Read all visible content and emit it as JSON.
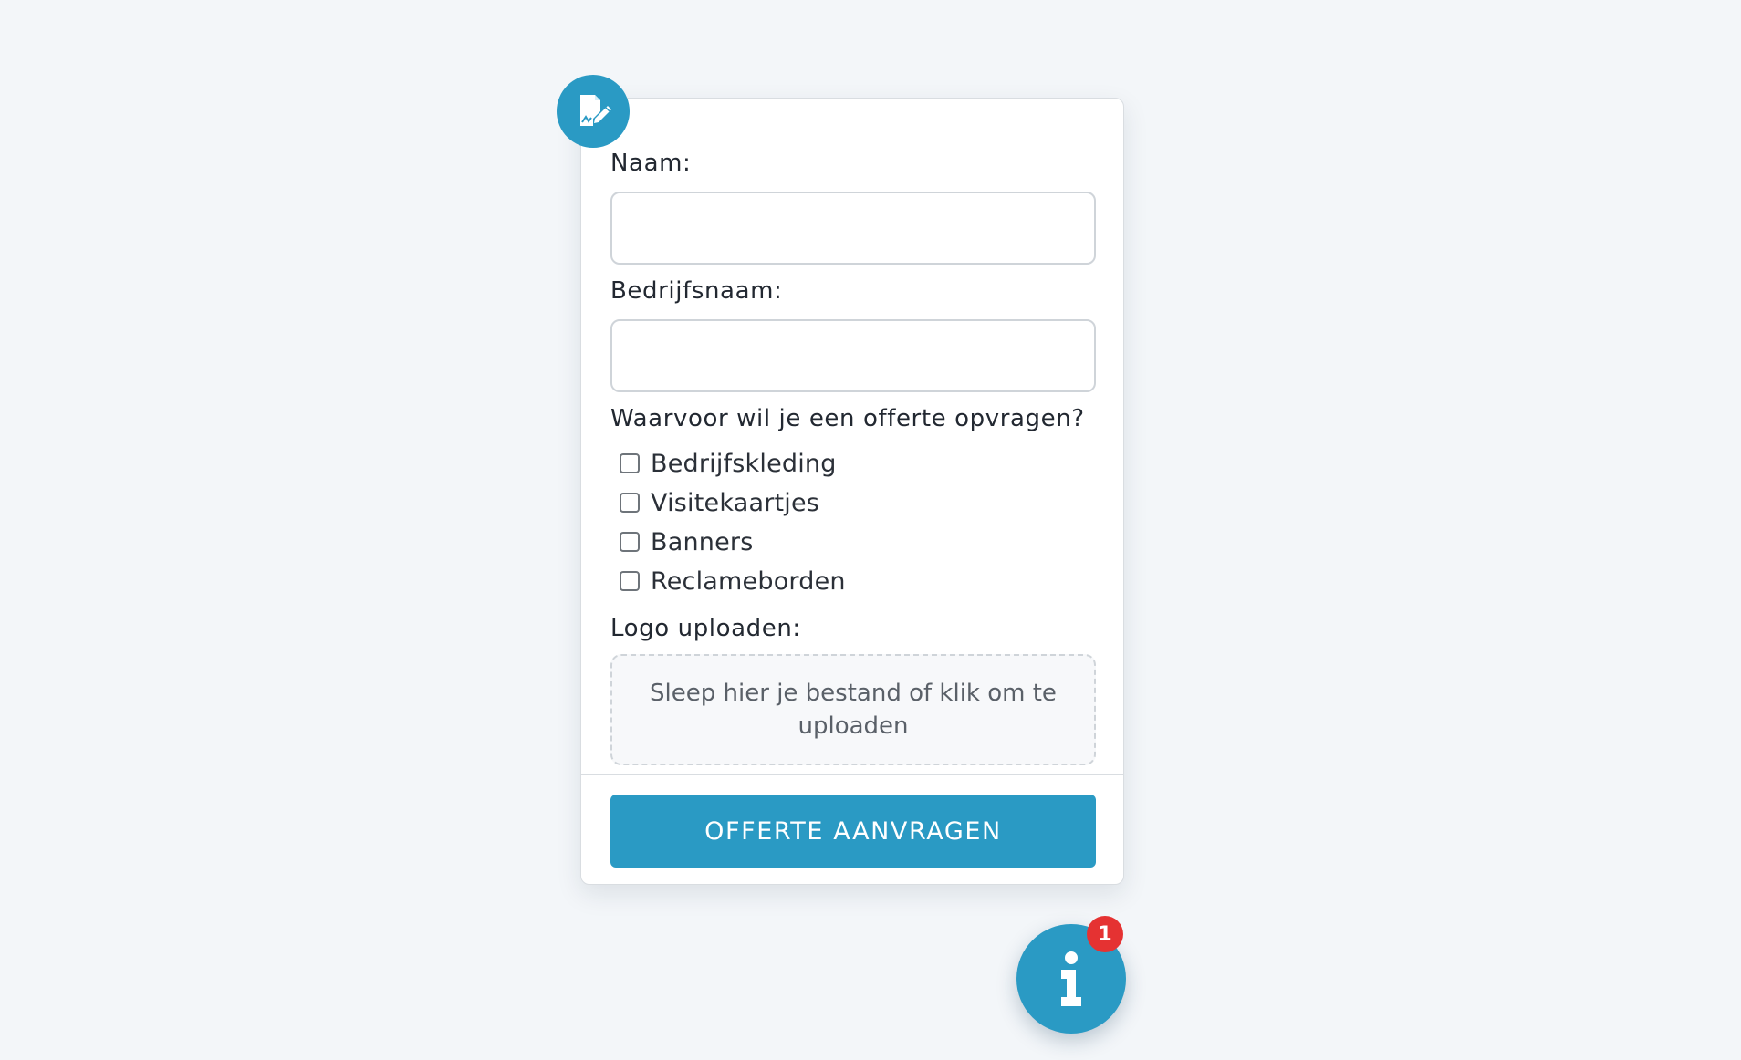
{
  "form": {
    "fields": {
      "naam_label": "Naam:",
      "naam_value": "",
      "bedrijfsnaam_label": "Bedrijfsnaam:",
      "bedrijfsnaam_value": ""
    },
    "question": "Waarvoor wil je een offerte opvragen?",
    "options": [
      {
        "label": "Bedrijfskleding",
        "checked": false
      },
      {
        "label": "Visitekaartjes",
        "checked": false
      },
      {
        "label": "Banners",
        "checked": false
      },
      {
        "label": "Reclameborden",
        "checked": false
      }
    ],
    "upload_label": "Logo uploaden:",
    "dropzone_text": "Sleep hier je bestand of klik om te uploaden",
    "submit_label": "OFFERTE AANVRAGEN"
  },
  "icons": {
    "form_badge": "document-edit-icon",
    "info_button": "info-icon"
  },
  "info_badge_count": "1",
  "colors": {
    "accent": "#2a9ac4",
    "badge": "#e53232",
    "background": "#f3f6f9"
  }
}
